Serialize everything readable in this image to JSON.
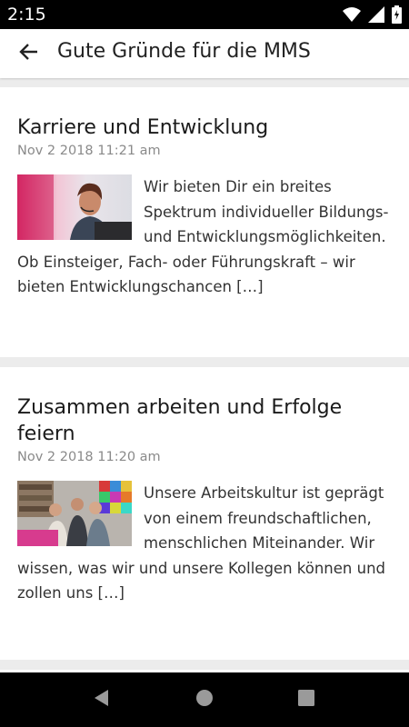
{
  "status_bar": {
    "time": "2:15",
    "icons": [
      "wifi-icon",
      "cellular-signal-icon",
      "battery-charging-icon"
    ]
  },
  "app_bar": {
    "title": "Gute Gründe für die MMS",
    "back_icon": "arrow-left-icon"
  },
  "articles": [
    {
      "title": "Karriere und Entwicklung",
      "date": "Nov 2 2018 11:21 am",
      "excerpt": "Wir bieten Dir ein breites Spektrum individueller Bildungs- und Entwicklungsmöglichkeiten. Ob Einsteiger, Fach- oder Führungskraft – wir bieten Entwicklungschancen […]",
      "thumbnail": "woman-with-headset-photo"
    },
    {
      "title": "Zusammen arbeiten und Erfolge feiern",
      "date": "Nov 2 2018 11:20 am",
      "excerpt": "Unsere Arbeitskultur ist geprägt von einem freundschaftlichen, menschlichen Miteinander. Wir wissen, was wir und unsere Kollegen können und zollen uns […]",
      "thumbnail": "team-group-photo"
    }
  ],
  "nav_bar": {
    "icons": [
      "back-triangle-icon",
      "home-circle-icon",
      "recents-square-icon"
    ]
  },
  "colors": {
    "background": "#ececec",
    "card": "#ffffff",
    "title_text": "#1a1a1a",
    "date_text": "#8a8a8a",
    "system_bars": "#000000"
  }
}
